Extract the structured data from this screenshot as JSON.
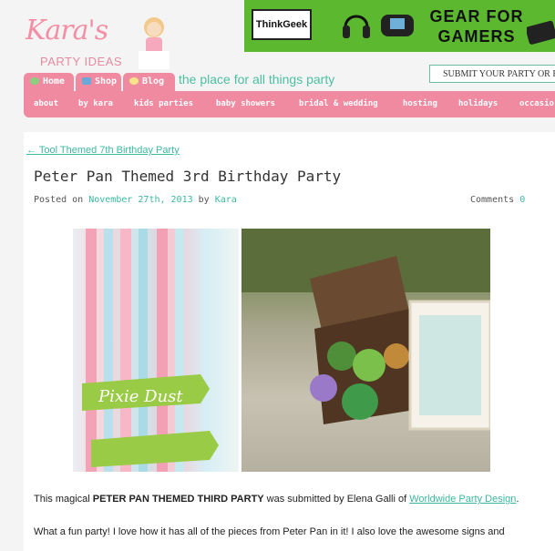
{
  "logo": {
    "script": "Kara's",
    "sub": "PARTY IDEAS"
  },
  "ad": {
    "brand": "ThinkGeek",
    "headline": "GEAR FOR GAMERS"
  },
  "tabs": [
    {
      "label": "Home"
    },
    {
      "label": "Shop"
    },
    {
      "label": "Blog"
    }
  ],
  "tagline": "the place for all things party",
  "submit_label": "SUBMIT YOUR PARTY OR RE",
  "nav": [
    "about",
    "by kara",
    "kids parties",
    "baby showers",
    "bridal & wedding",
    "hosting",
    "holidays",
    "occasio"
  ],
  "post": {
    "back_link": "← Tool Themed 7th Birthday Party",
    "title": "Peter Pan Themed 3rd Birthday Party",
    "posted_on": "Posted on",
    "date": "November 27th, 2013",
    "by": "by",
    "author": "Kara",
    "comments_label": "Comments",
    "comments_count": "0",
    "photo1_text": "Pixie Dust",
    "para_pre": "This magical ",
    "para_bold": "PETER PAN THEMED THIRD PARTY",
    "para_mid": " was submitted by Elena Galli of ",
    "para_link": "Worldwide Party Design",
    "para_end": ".",
    "para2": "What a fun party! I love how it has all of the pieces from Peter Pan in it! I also love the awesome signs and"
  },
  "colors": {
    "pink": "#f08aa0",
    "teal": "#3cb8a0",
    "green": "#5cb82e"
  }
}
